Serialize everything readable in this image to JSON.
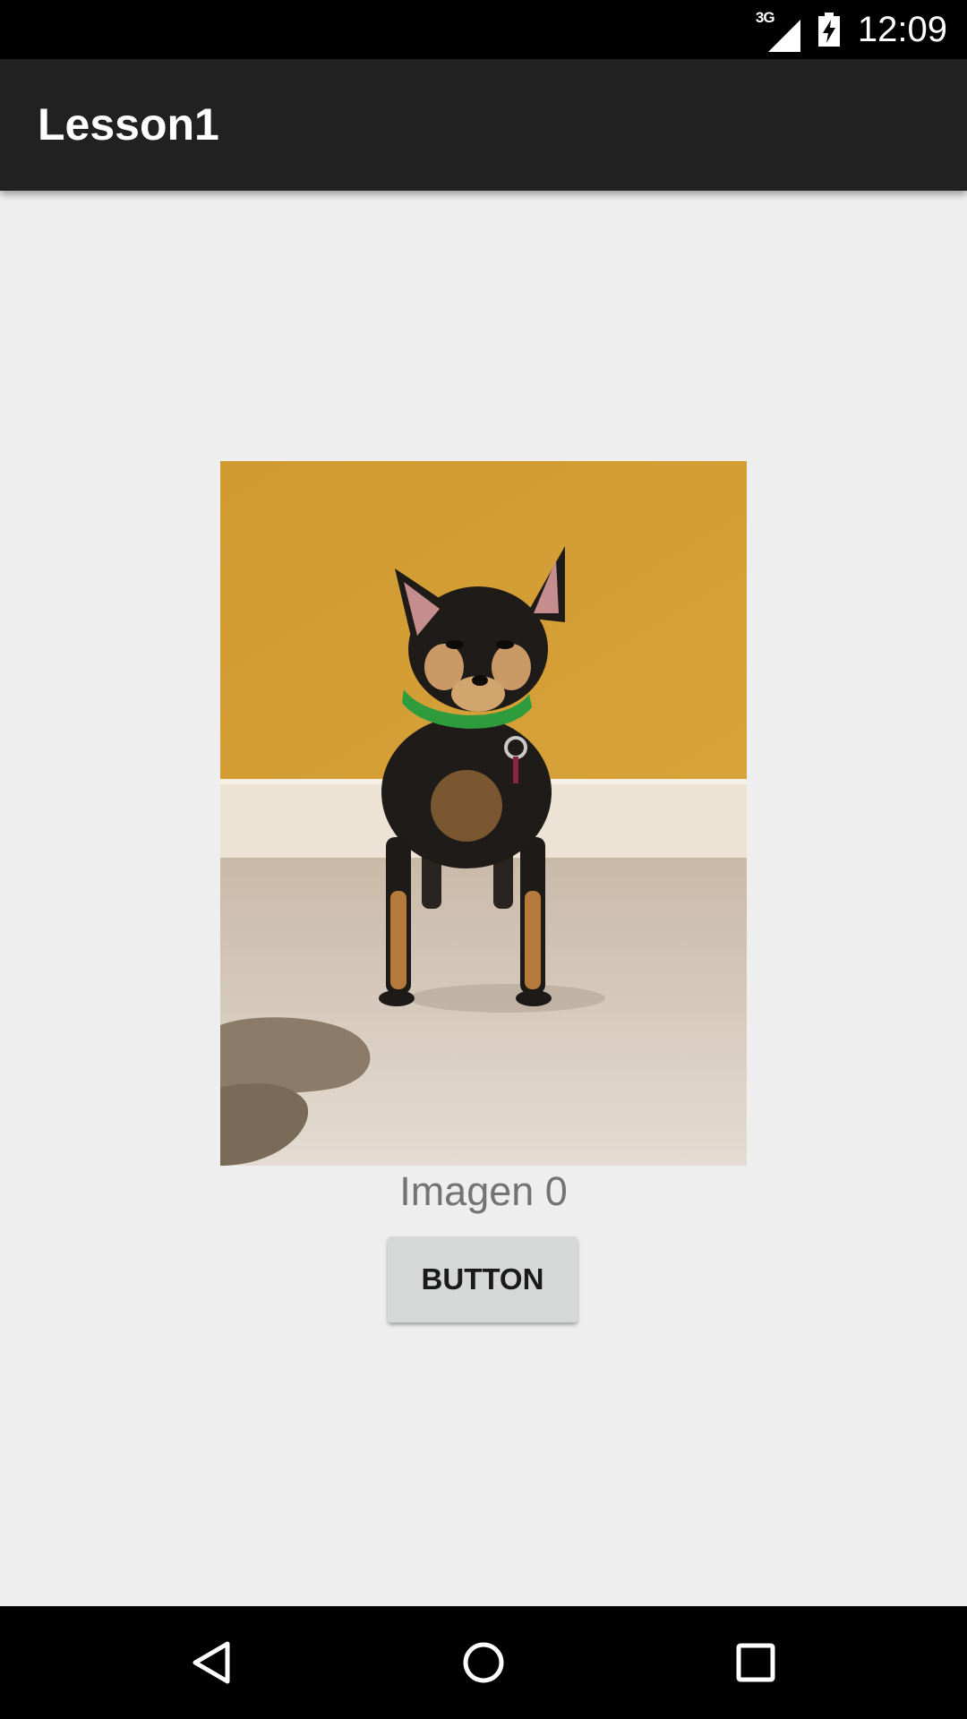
{
  "status_bar": {
    "network_type": "3G",
    "time": "12:09",
    "icons": [
      "signal-icon",
      "battery-charging-icon"
    ]
  },
  "action_bar": {
    "title": "Lesson1"
  },
  "main": {
    "image_icon": "dog-photo",
    "caption": "Imagen 0",
    "button_label": "BUTTON"
  },
  "nav_bar": {
    "icons": [
      "back-icon",
      "home-icon",
      "recents-icon"
    ]
  },
  "colors": {
    "status_bar": "#000000",
    "action_bar": "#212121",
    "background": "#eeeeee",
    "button": "#d6d7d7",
    "caption_text": "#737373"
  }
}
